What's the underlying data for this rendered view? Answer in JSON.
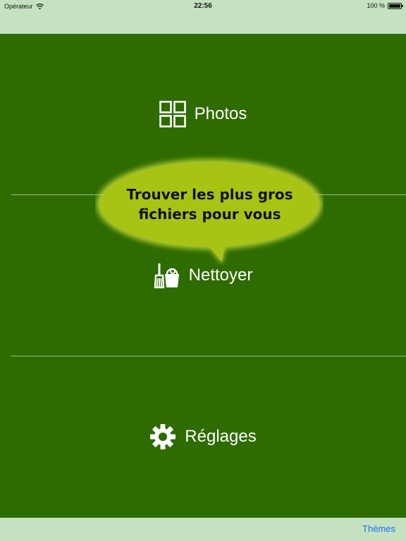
{
  "status": {
    "carrier": "Opérateur",
    "time": "22:56",
    "battery": "100 %"
  },
  "menu": {
    "photos_label": "Photos",
    "clean_label": "Nettoyer",
    "settings_label": "Réglages"
  },
  "bubble": {
    "line1": "Trouver les plus gros",
    "line2": "fichiers pour vous"
  },
  "bottom": {
    "themes_label": "Thèmes"
  },
  "colors": {
    "bar_background": "#c4e2c0",
    "main_background": "#2e6b00",
    "bubble_fill": "#a9c315",
    "link": "#1a6ff0"
  },
  "icons": {
    "photos": "grid-icon",
    "clean": "broom-bucket-icon",
    "settings": "gear-icon",
    "wifi": "wifi-icon",
    "battery": "battery-icon"
  }
}
